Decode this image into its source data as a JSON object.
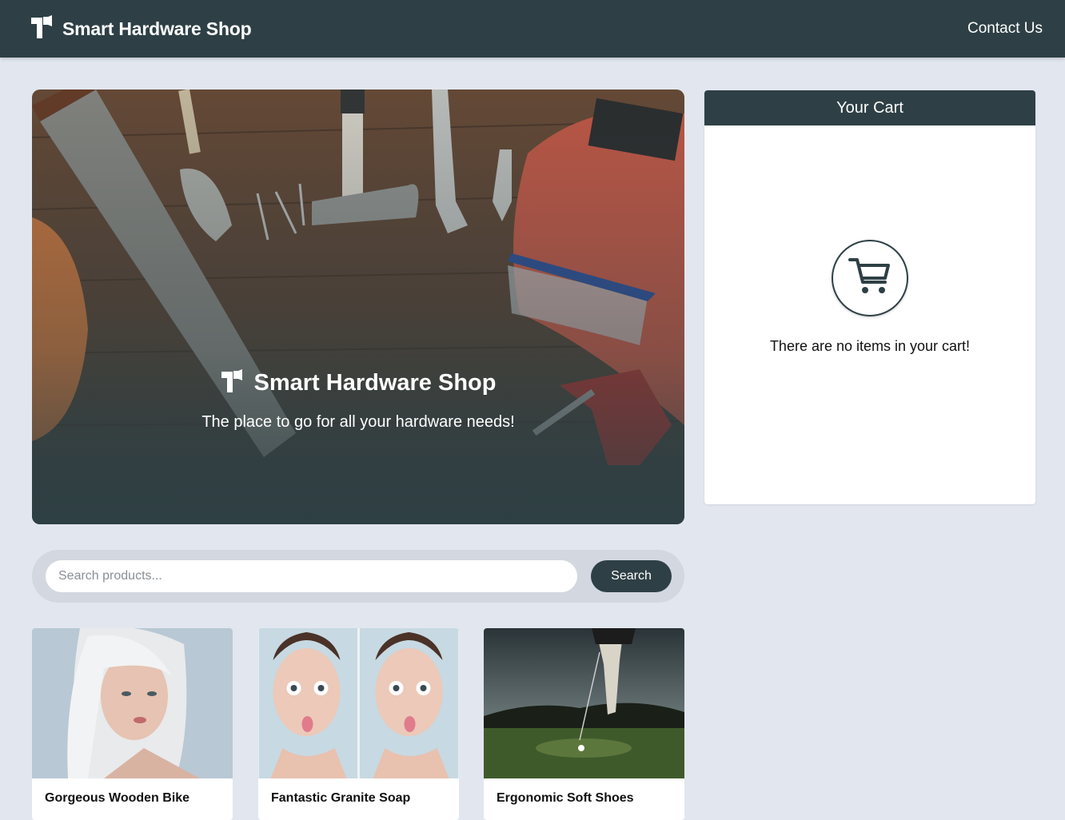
{
  "navbar": {
    "brand": "Smart Hardware Shop",
    "contact_label": "Contact Us"
  },
  "hero": {
    "title": "Smart Hardware Shop",
    "subtitle": "The place to go for all your hardware needs!"
  },
  "cart": {
    "title": "Your Cart",
    "empty_message": "There are no items in your cart!"
  },
  "search": {
    "placeholder": "Search products...",
    "value": "",
    "button_label": "Search"
  },
  "products": [
    {
      "name": "Gorgeous Wooden Bike"
    },
    {
      "name": "Fantastic Granite Soap"
    },
    {
      "name": "Ergonomic Soft Shoes"
    }
  ],
  "colors": {
    "brand_dark": "#2e4045",
    "page_bg": "#e2e6ee"
  }
}
